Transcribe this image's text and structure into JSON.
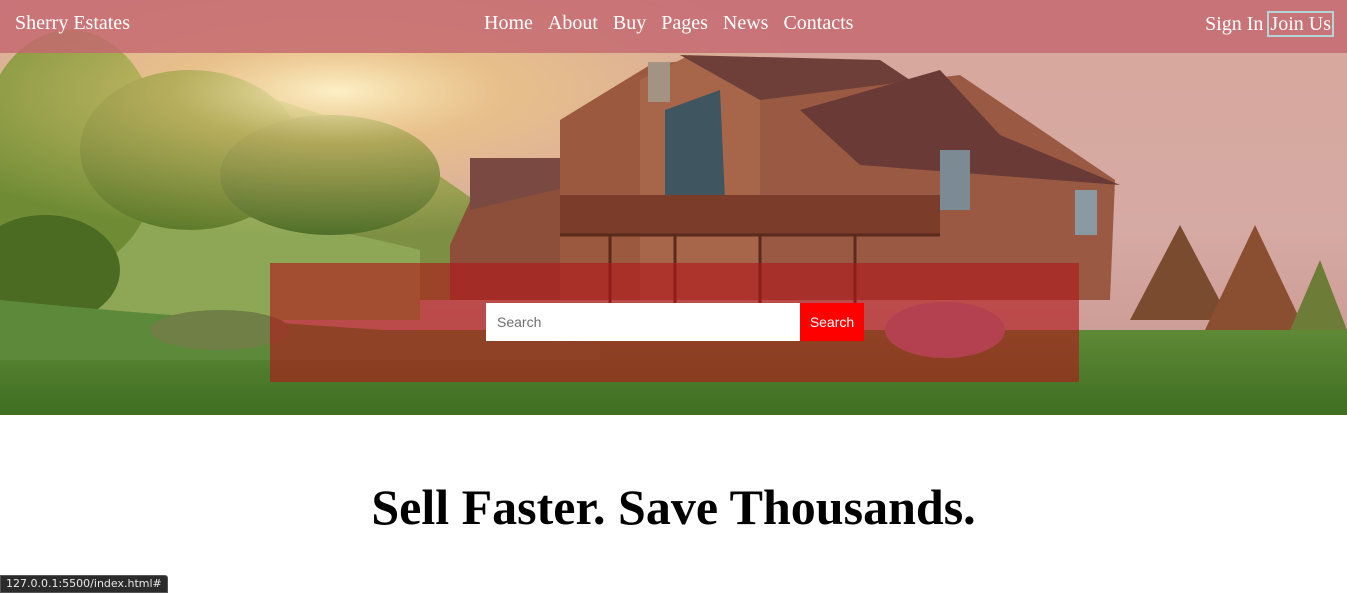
{
  "nav": {
    "brand": "Sherry Estates",
    "links": [
      "Home",
      "About",
      "Buy",
      "Pages",
      "News",
      "Contacts"
    ],
    "sign_in": "Sign In",
    "join": "Join Us"
  },
  "search": {
    "placeholder": "Search",
    "button": "Search"
  },
  "heading": "Sell Faster. Save Thousands.",
  "status_url": "127.0.0.1:5500/index.html#",
  "colors": {
    "navbar": "#c46870",
    "search_panel": "#b0161c",
    "search_button": "#ff0000",
    "join_border": "#b9d2d6"
  }
}
